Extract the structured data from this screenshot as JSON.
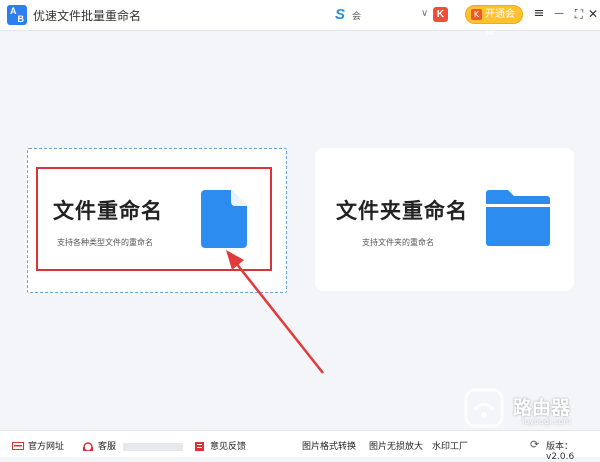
{
  "app": {
    "title": "优速文件批量重命名",
    "logo_text_top": "A",
    "logo_text_bottom": "B"
  },
  "user": {
    "logo_glyph": "S",
    "name": "会",
    "dropdown_glyph": "∨",
    "badge_glyph": "K"
  },
  "vip": {
    "label": "开通会员",
    "icon_glyph": "K"
  },
  "window_controls": {
    "menu": "≡",
    "minimize": "—",
    "maximize": "⛶",
    "close": "✕"
  },
  "cards": [
    {
      "title": "文件重命名",
      "subtitle": "支持各种类型文件的重命名",
      "icon": "file-icon"
    },
    {
      "title": "文件夹重命名",
      "subtitle": "支持文件夹的重命名",
      "icon": "folder-icon"
    }
  ],
  "footer": {
    "links": [
      {
        "label": "官方网址",
        "icon": "monitor-icon"
      },
      {
        "label": "客服",
        "icon": "headset-icon"
      },
      {
        "label": "意见反馈",
        "icon": "feedback-icon"
      },
      {
        "label": "图片格式转换"
      },
      {
        "label": "图片无损放大"
      },
      {
        "label": "水印工厂"
      }
    ],
    "version": "版本：v2.0.6"
  },
  "watermark": {
    "text": "路由器",
    "url": "luyouqi.com"
  },
  "colors": {
    "accent_blue": "#2d8cf0",
    "highlight_red": "#d9333a",
    "vip_orange": "#ffc12e",
    "background": "#f3f5f8"
  }
}
